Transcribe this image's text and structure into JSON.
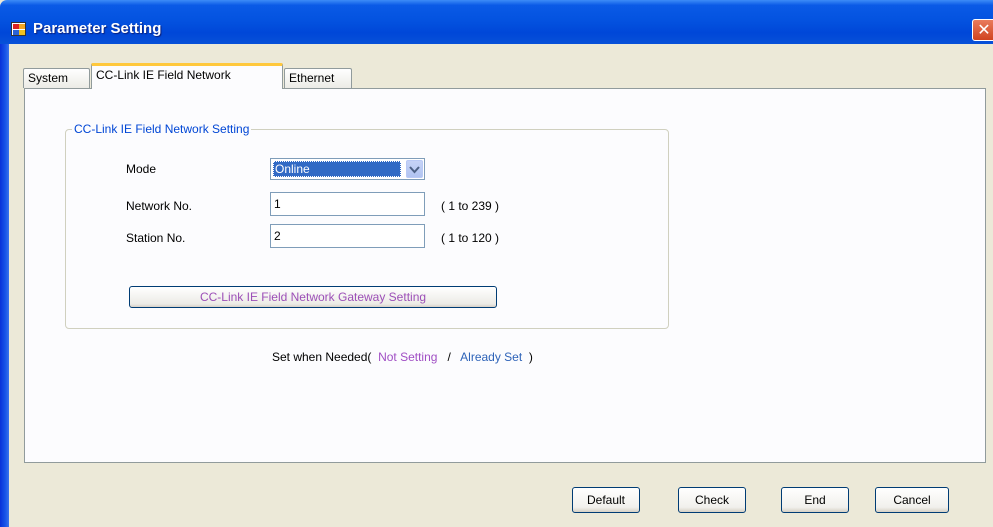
{
  "window": {
    "title": "Parameter Setting",
    "close_glyph": "✕"
  },
  "tabs": [
    {
      "label": "System"
    },
    {
      "label": "CC-Link IE Field Network"
    },
    {
      "label": "Ethernet"
    }
  ],
  "active_tab": "CC-Link IE Field Network",
  "group": {
    "title": "CC-Link IE Field Network Setting",
    "mode_label": "Mode",
    "mode_value": "Online",
    "network_label": "Network No.",
    "network_value": "1",
    "network_range": "( 1 to 239 )",
    "station_label": "Station No.",
    "station_value": "2",
    "station_range": "( 1 to 120 )",
    "gateway_button": "CC-Link IE Field Network Gateway Setting"
  },
  "legend": {
    "prefix": "Set when Needed(",
    "not_setting": "Not Setting",
    "separator": "/",
    "already_set": "Already Set",
    "suffix": ")",
    "not_setting_color": "#a04ec4",
    "already_set_color": "#2e63b8"
  },
  "footer": {
    "default_label": "Default",
    "check_label": "Check",
    "end_label": "End",
    "cancel_label": "Cancel"
  },
  "colors": {
    "title_bar": "#0453e0",
    "active_tab_accent": "#ffc83c",
    "group_title": "#0046d5",
    "selection": "#316ac5"
  },
  "icons": {
    "title": "app-window-icon",
    "close": "close-icon",
    "dropdown": "chevron-down-icon"
  }
}
